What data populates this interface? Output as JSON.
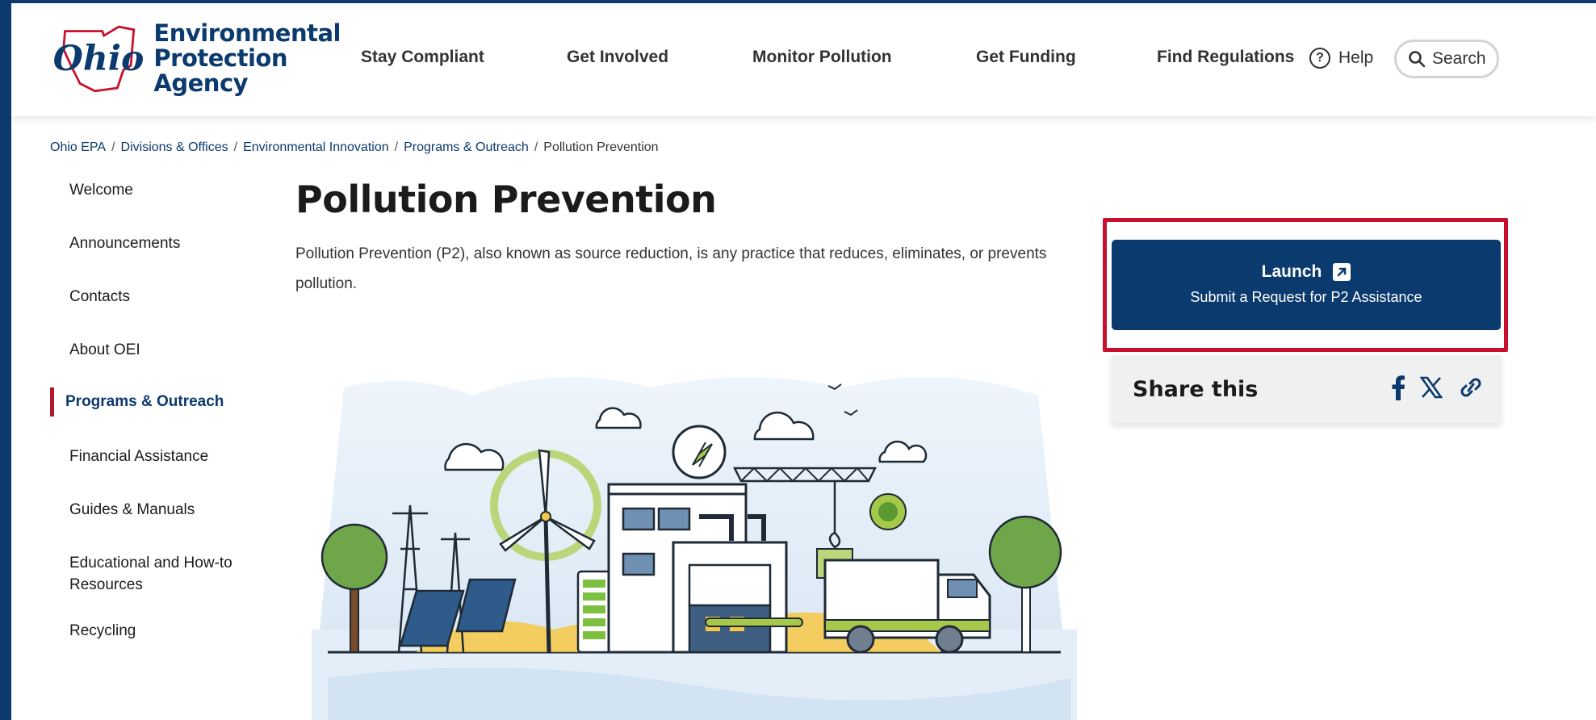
{
  "brand": {
    "logo_script": "Ohio",
    "name_lines": [
      "Environmental",
      "Protection",
      "Agency"
    ],
    "navy": "#0b3a6e",
    "red": "#c8102e"
  },
  "nav": [
    {
      "label": "Stay Compliant"
    },
    {
      "label": "Get Involved"
    },
    {
      "label": "Monitor Pollution"
    },
    {
      "label": "Get Funding"
    },
    {
      "label": "Find Regulations"
    }
  ],
  "header": {
    "help_label": "Help",
    "help_icon": "question-circle-icon",
    "search_label": "Search",
    "search_icon": "search-icon"
  },
  "breadcrumb": {
    "items": [
      "Ohio EPA",
      "Divisions & Offices",
      "Environmental Innovation",
      "Programs & Outreach"
    ],
    "current": "Pollution Prevention"
  },
  "sidebar": {
    "items": [
      {
        "label": "Welcome"
      },
      {
        "label": "Announcements"
      },
      {
        "label": "Contacts"
      },
      {
        "label": "About OEI"
      },
      {
        "label": "Programs & Outreach",
        "active": true
      },
      {
        "label": "Financial Assistance"
      },
      {
        "label": "Guides & Manuals"
      },
      {
        "label": "Educational and How-to Resources"
      },
      {
        "label": "Recycling"
      }
    ]
  },
  "main": {
    "title": "Pollution Prevention",
    "intro": "Pollution Prevention (P2), also known as source reduction, is any practice that reduces, eliminates, or prevents pollution."
  },
  "launch": {
    "title": "Launch",
    "subtitle": "Submit a Request for P2 Assistance",
    "icon": "external-link-icon"
  },
  "share": {
    "label": "Share this",
    "icons": [
      "facebook-icon",
      "x-icon",
      "link-icon"
    ]
  }
}
